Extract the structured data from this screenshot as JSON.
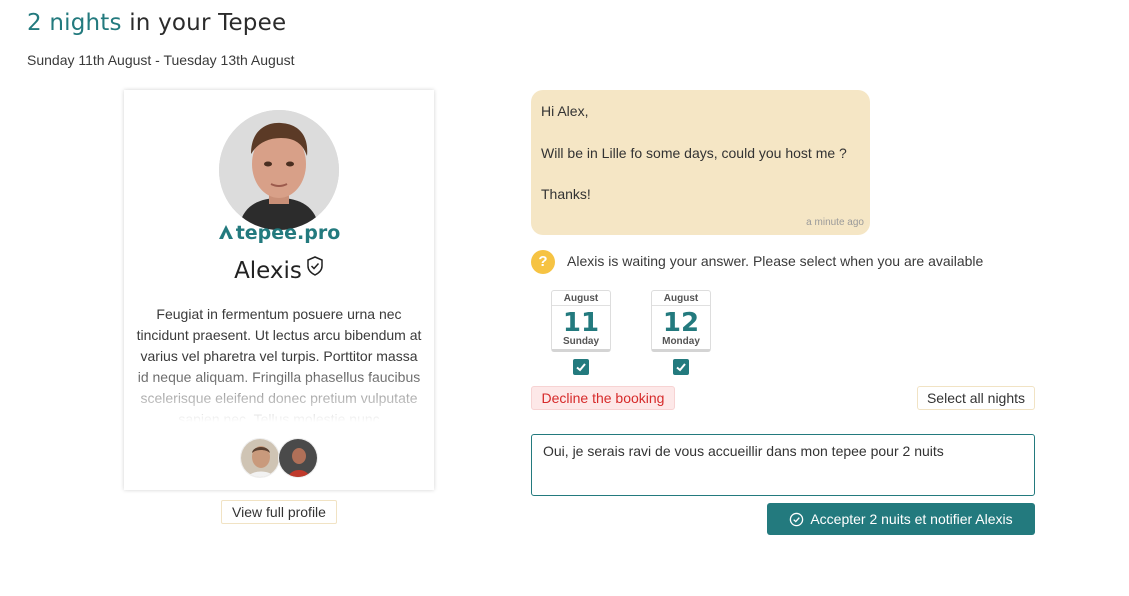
{
  "header": {
    "title_accent": "2 nights",
    "title_rest": " in your Tepee",
    "dates": "Sunday 11th August - Tuesday 13th August"
  },
  "profile": {
    "brand": "tepee.pro",
    "name": "Alexis",
    "bio": "Feugiat in fermentum posuere urna nec tincidunt praesent. Ut lectus arcu bibendum at varius vel pharetra vel turpis. Porttitor massa id neque aliquam. Fringilla phasellus faucibus scelerisque eleifend donec pretium vulputate sapien nec. Tellus molestie nunc",
    "view_profile_label": "View full profile"
  },
  "message": {
    "greeting": "Hi Alex,",
    "body": "Will be in Lille fo some days, could you host me ?",
    "closing": "Thanks!",
    "timestamp": "a minute ago"
  },
  "waiting": {
    "icon": "?",
    "text": "Alexis is waiting your answer. Please select when you are available"
  },
  "nights": [
    {
      "month": "August",
      "day": "11",
      "weekday": "Sunday",
      "checked": true
    },
    {
      "month": "August",
      "day": "12",
      "weekday": "Monday",
      "checked": true
    }
  ],
  "actions": {
    "decline_label": "Decline the booking",
    "select_all_label": "Select all nights",
    "reply_value": "Oui, je serais ravi de vous accueillir dans mon tepee pour 2 nuits",
    "accept_label": "Accepter 2 nuits et notifier Alexis"
  },
  "colors": {
    "accent": "#237a7e",
    "bubble": "#f5e6c5",
    "decline_text": "#d62a2a",
    "warning": "#f6c343"
  }
}
